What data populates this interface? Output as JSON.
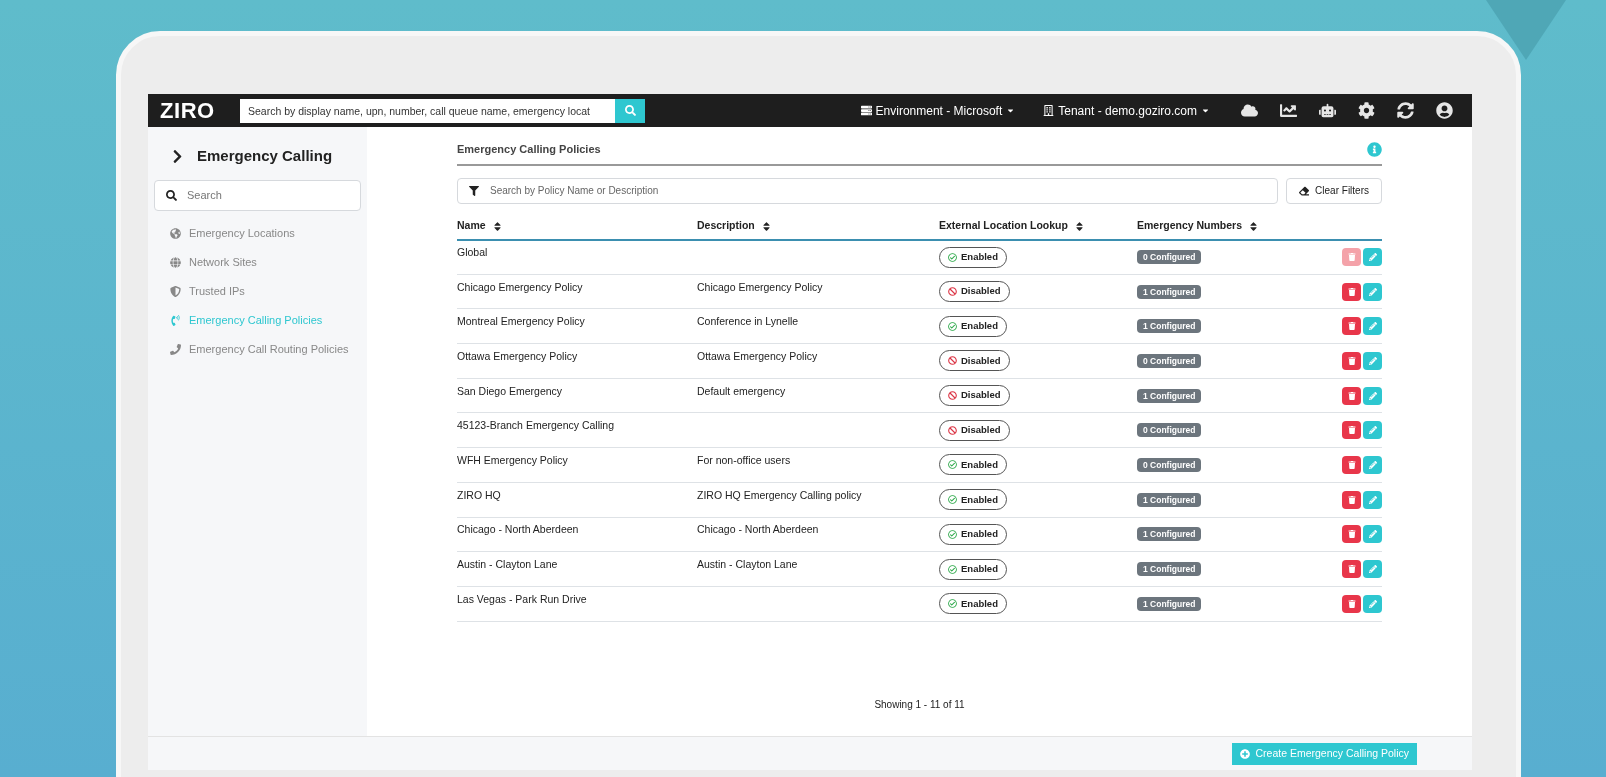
{
  "topbar": {
    "logo": "ZIRO",
    "search": {
      "placeholder": "Search by display name, upn, number, call queue name, emergency locat"
    },
    "environment": "Environment - Microsoft",
    "tenant": "Tenant - demo.goziro.com"
  },
  "sidebar": {
    "title": "Emergency Calling",
    "search": {
      "placeholder": "Search"
    },
    "items": [
      {
        "label": "Emergency Locations",
        "selected": false
      },
      {
        "label": "Network Sites",
        "selected": false
      },
      {
        "label": "Trusted IPs",
        "selected": false
      },
      {
        "label": "Emergency Calling Policies",
        "selected": true
      },
      {
        "label": "Emergency Call Routing Policies",
        "selected": false
      }
    ]
  },
  "page": {
    "title": "Emergency Calling Policies",
    "filter": {
      "placeholder": "Search by Policy Name or Description"
    },
    "clear_filters": "Clear Filters"
  },
  "table": {
    "columns": [
      "Name",
      "Description",
      "External Location Lookup",
      "Emergency Numbers"
    ],
    "rows": [
      {
        "name": "Global",
        "description": "",
        "lookup": "Enabled",
        "enabled": true,
        "numbers": "0 Configured",
        "delete_disabled": true
      },
      {
        "name": "Chicago Emergency Policy",
        "description": "Chicago Emergency Policy",
        "lookup": "Disabled",
        "enabled": false,
        "numbers": "1 Configured",
        "delete_disabled": false
      },
      {
        "name": "Montreal Emergency Policy",
        "description": "Conference in Lynelle",
        "lookup": "Enabled",
        "enabled": true,
        "numbers": "1 Configured",
        "delete_disabled": false
      },
      {
        "name": "Ottawa Emergency Policy",
        "description": "Ottawa Emergency Policy",
        "lookup": "Disabled",
        "enabled": false,
        "numbers": "0 Configured",
        "delete_disabled": false
      },
      {
        "name": "San Diego Emergency",
        "description": "Default emergency",
        "lookup": "Disabled",
        "enabled": false,
        "numbers": "1 Configured",
        "delete_disabled": false
      },
      {
        "name": "45123-Branch Emergency Calling",
        "description": "",
        "lookup": "Disabled",
        "enabled": false,
        "numbers": "0 Configured",
        "delete_disabled": false
      },
      {
        "name": "WFH Emergency Policy",
        "description": "For non-office users",
        "lookup": "Enabled",
        "enabled": true,
        "numbers": "0 Configured",
        "delete_disabled": false
      },
      {
        "name": "ZIRO HQ",
        "description": "ZIRO HQ Emergency Calling policy",
        "lookup": "Enabled",
        "enabled": true,
        "numbers": "1 Configured",
        "delete_disabled": false
      },
      {
        "name": "Chicago - North Aberdeen",
        "description": "Chicago - North Aberdeen",
        "lookup": "Enabled",
        "enabled": true,
        "numbers": "1 Configured",
        "delete_disabled": false
      },
      {
        "name": "Austin - Clayton Lane",
        "description": "Austin - Clayton Lane",
        "lookup": "Enabled",
        "enabled": true,
        "numbers": "1 Configured",
        "delete_disabled": false
      },
      {
        "name": "Las Vegas - Park Run Drive",
        "description": "",
        "lookup": "Enabled",
        "enabled": true,
        "numbers": "1 Configured",
        "delete_disabled": false
      }
    ]
  },
  "pagination": "Showing 1 - 11 of 11",
  "create_button": "Create Emergency Calling Policy"
}
